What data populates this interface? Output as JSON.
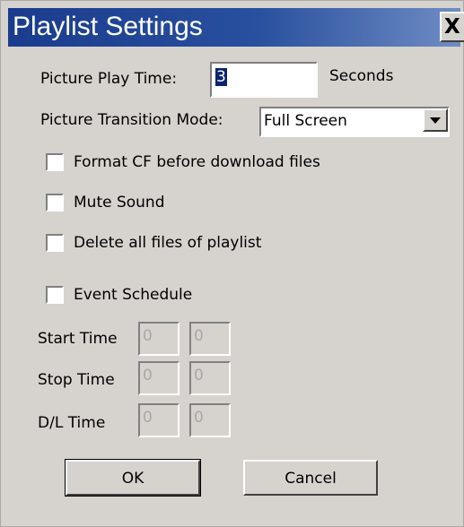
{
  "dialog": {
    "title": "Playlist Settings",
    "close_icon": "close-icon",
    "close_label": "X"
  },
  "play_time": {
    "label": "Picture Play Time:",
    "value": "3",
    "unit": "Seconds"
  },
  "transition": {
    "label": "Picture Transition Mode:",
    "selected": "Full Screen"
  },
  "options": {
    "format_cf": {
      "label": "Format CF before download files",
      "checked": false
    },
    "mute_sound": {
      "label": "Mute Sound",
      "checked": false
    },
    "delete_files": {
      "label": "Delete all files of playlist",
      "checked": false
    },
    "event_schedule": {
      "label": "Event Schedule",
      "checked": false
    }
  },
  "schedule": {
    "start": {
      "label": "Start Time",
      "hour": "0",
      "minute": "0"
    },
    "stop": {
      "label": "Stop Time",
      "hour": "0",
      "minute": "0"
    },
    "dl": {
      "label": "D/L Time",
      "hour": "0",
      "minute": "0"
    }
  },
  "buttons": {
    "ok": "OK",
    "cancel": "Cancel"
  },
  "colors": {
    "titlebar": "#1b3c8e",
    "dialog_bg": "#d6d3ce",
    "selection": "#0a246a"
  }
}
